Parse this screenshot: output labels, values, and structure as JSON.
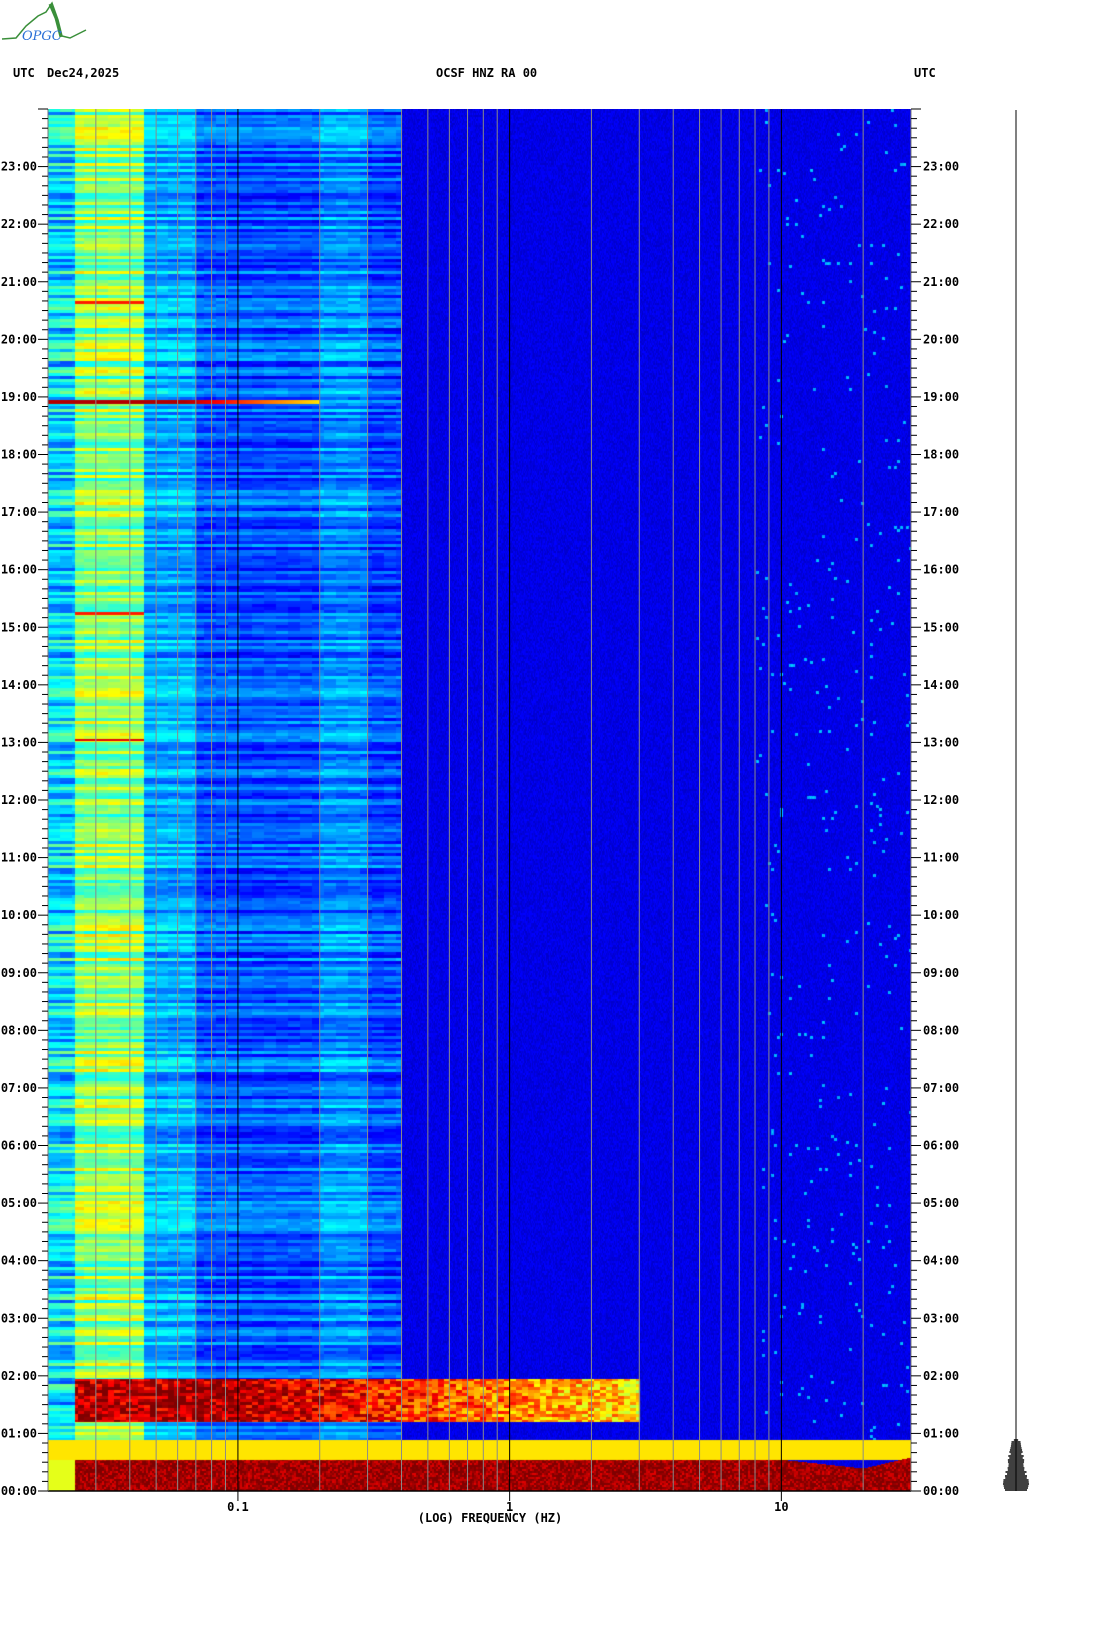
{
  "logo": {
    "text": "OPGC",
    "brand_green": "#3a8f3a",
    "brand_blue": "#2a6fd6"
  },
  "header": {
    "left_tz": "UTC",
    "date": "Dec24,2025",
    "station": "OCSF HNZ RA 00",
    "right_tz": "UTC"
  },
  "chart_data": {
    "type": "heatmap",
    "title": "OCSF HNZ RA 00",
    "xlabel": "(LOG) FREQUENCY (HZ)",
    "ylabel": "UTC",
    "x_scale": "log",
    "xlim": [
      0.02,
      30
    ],
    "ylim_hours": [
      0,
      24
    ],
    "x_ticks": [
      {
        "value": 0.1,
        "label": "0.1"
      },
      {
        "value": 1,
        "label": "1"
      },
      {
        "value": 10,
        "label": "10"
      }
    ],
    "y_ticks": [
      "00:00",
      "01:00",
      "02:00",
      "03:00",
      "04:00",
      "05:00",
      "06:00",
      "07:00",
      "08:00",
      "09:00",
      "10:00",
      "11:00",
      "12:00",
      "13:00",
      "14:00",
      "15:00",
      "16:00",
      "17:00",
      "18:00",
      "19:00",
      "20:00",
      "21:00",
      "22:00",
      "23:00"
    ],
    "colormap": "jet",
    "intensity_scale": [
      0,
      1
    ],
    "background_profile": [
      {
        "f_min": 0.02,
        "f_max": 0.025,
        "intensity": 0.35
      },
      {
        "f_min": 0.025,
        "f_max": 0.045,
        "intensity": 0.52
      },
      {
        "f_min": 0.045,
        "f_max": 0.07,
        "intensity": 0.3
      },
      {
        "f_min": 0.07,
        "f_max": 0.2,
        "intensity": 0.21
      },
      {
        "f_min": 0.2,
        "f_max": 0.3,
        "intensity": 0.27
      },
      {
        "f_min": 0.3,
        "f_max": 0.4,
        "intensity": 0.2
      },
      {
        "f_min": 0.4,
        "f_max": 30,
        "intensity": 0.1
      }
    ],
    "events": [
      {
        "start_hour": 0.0,
        "end_hour": 0.55,
        "f_min": 0.025,
        "f_max": 30,
        "intensity": 1.0
      },
      {
        "start_hour": 0.55,
        "end_hour": 0.9,
        "f_min": 0.02,
        "f_max": 30,
        "intensity": 0.65
      },
      {
        "start_hour": 1.2,
        "end_hour": 1.95,
        "f_min": 0.025,
        "f_max": 3,
        "intensity": 0.95
      },
      {
        "start_hour": 18.88,
        "end_hour": 18.95,
        "f_min": 0.02,
        "f_max": 0.2,
        "intensity": 0.95
      },
      {
        "start_hour": 13.03,
        "end_hour": 13.07,
        "f_min": 0.025,
        "f_max": 0.045,
        "intensity": 0.9
      },
      {
        "start_hour": 15.23,
        "end_hour": 15.27,
        "f_min": 0.025,
        "f_max": 0.045,
        "intensity": 0.85
      },
      {
        "start_hour": 20.63,
        "end_hour": 20.67,
        "f_min": 0.025,
        "f_max": 0.045,
        "intensity": 0.85
      }
    ],
    "grid": true,
    "legend": "none"
  }
}
